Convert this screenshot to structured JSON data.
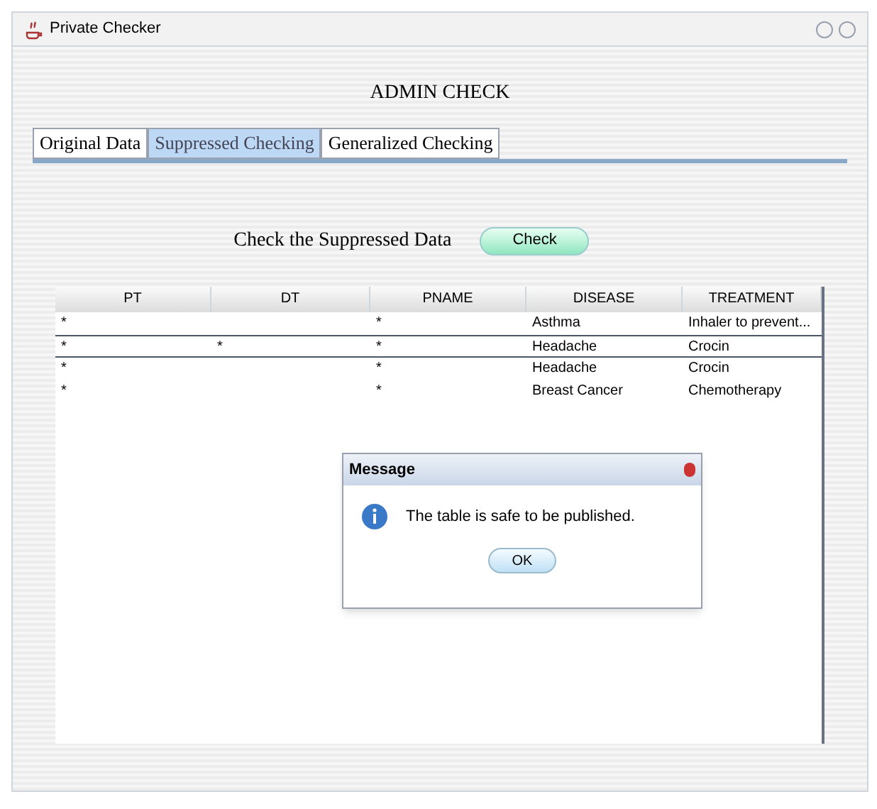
{
  "window": {
    "title": "Private Checker"
  },
  "heading": "ADMIN CHECK",
  "tabs": [
    {
      "label": "Original Data",
      "selected": false
    },
    {
      "label": "Suppressed Checking",
      "selected": true
    },
    {
      "label": "Generalized Checking",
      "selected": false
    }
  ],
  "prompt": "Check the Suppressed Data",
  "check_button": "Check",
  "table": {
    "columns": [
      "PT",
      "DT",
      "PNAME",
      "DISEASE",
      "TREATMENT"
    ],
    "rows": [
      {
        "cells": [
          "*",
          "",
          "*",
          "Asthma",
          "Inhaler to prevent..."
        ],
        "selected": false
      },
      {
        "cells": [
          "*",
          "*",
          "*",
          "Headache",
          "Crocin"
        ],
        "selected": true
      },
      {
        "cells": [
          "*",
          "",
          "*",
          "Headache",
          "Crocin"
        ],
        "selected": false
      },
      {
        "cells": [
          "*",
          "",
          "*",
          "Breast Cancer",
          "Chemotherapy"
        ],
        "selected": false
      }
    ]
  },
  "dialog": {
    "title": "Message",
    "message": "The table is safe to be published.",
    "button": "OK"
  }
}
